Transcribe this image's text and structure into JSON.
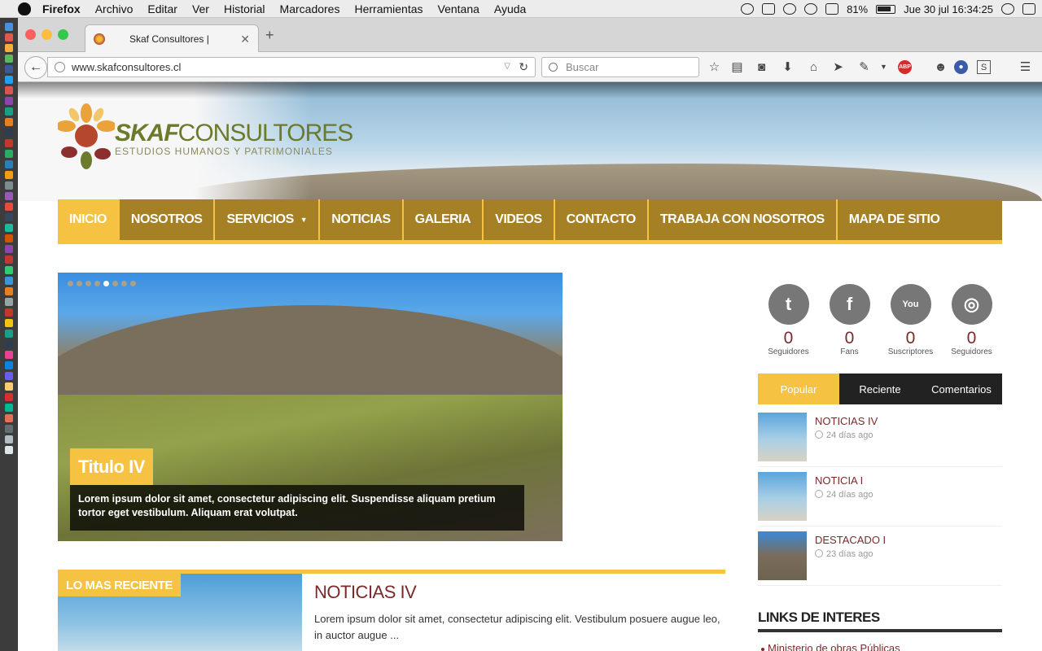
{
  "menubar": {
    "app": "Firefox",
    "items": [
      "Archivo",
      "Editar",
      "Ver",
      "Historial",
      "Marcadores",
      "Herramientas",
      "Ventana",
      "Ayuda"
    ],
    "battery": "81%",
    "datetime": "Jue 30 jul  16:34:25"
  },
  "browser": {
    "tab_title": "Skaf Consultores |",
    "url": "www.skafconsultores.cl",
    "search_placeholder": "Buscar"
  },
  "site": {
    "logo_brand_bold": "SKAF",
    "logo_brand": "CONSULTORES",
    "logo_tagline": "ESTUDIOS HUMANOS Y PATRIMONIALES",
    "nav": [
      "INICIO",
      "NOSOTROS",
      "SERVICIOS",
      "NOTICIAS",
      "GALERIA",
      "VIDEOS",
      "CONTACTO",
      "TRABAJA CON NOSOTROS",
      "MAPA DE SITIO"
    ],
    "nav_active": "INICIO",
    "slider": {
      "title": "Titulo IV",
      "description": "Lorem ipsum dolor sit amet, consectetur adipiscing elit. Suspendisse aliquam pretium tortor eget vestibulum. Aliquam erat volutpat.",
      "dot_count": 8,
      "active_dot": 5
    },
    "recent": {
      "label": "LO MAS RECIENTE",
      "title": "NOTICIAS IV",
      "text": "Lorem ipsum dolor sit amet, consectetur adipiscing elit. Vestibulum posuere augue leo, in auctor augue ..."
    },
    "social": [
      {
        "icon": "twitter-icon",
        "glyph": "t",
        "count": "0",
        "label": "Seguidores"
      },
      {
        "icon": "facebook-icon",
        "glyph": "f",
        "count": "0",
        "label": "Fans"
      },
      {
        "icon": "youtube-icon",
        "glyph": "You",
        "count": "0",
        "label": "Suscriptores"
      },
      {
        "icon": "instagram-icon",
        "glyph": "◎",
        "count": "0",
        "label": "Seguidores"
      }
    ],
    "tabs": [
      "Popular",
      "Reciente",
      "Comentarios"
    ],
    "tabs_active": "Popular",
    "posts": [
      {
        "title": "NOTICIAS IV",
        "date": "24 días ago"
      },
      {
        "title": "NOTICIA I",
        "date": "24 días ago"
      },
      {
        "title": "DESTACADO I",
        "date": "23 días ago"
      }
    ],
    "links_heading": "LINKS DE INTERES",
    "links": [
      "Ministerio de obras Públicas"
    ]
  },
  "colors": {
    "accent_yellow": "#f5c242",
    "nav_brown": "#a58024",
    "title_red": "#7a2a2a"
  }
}
